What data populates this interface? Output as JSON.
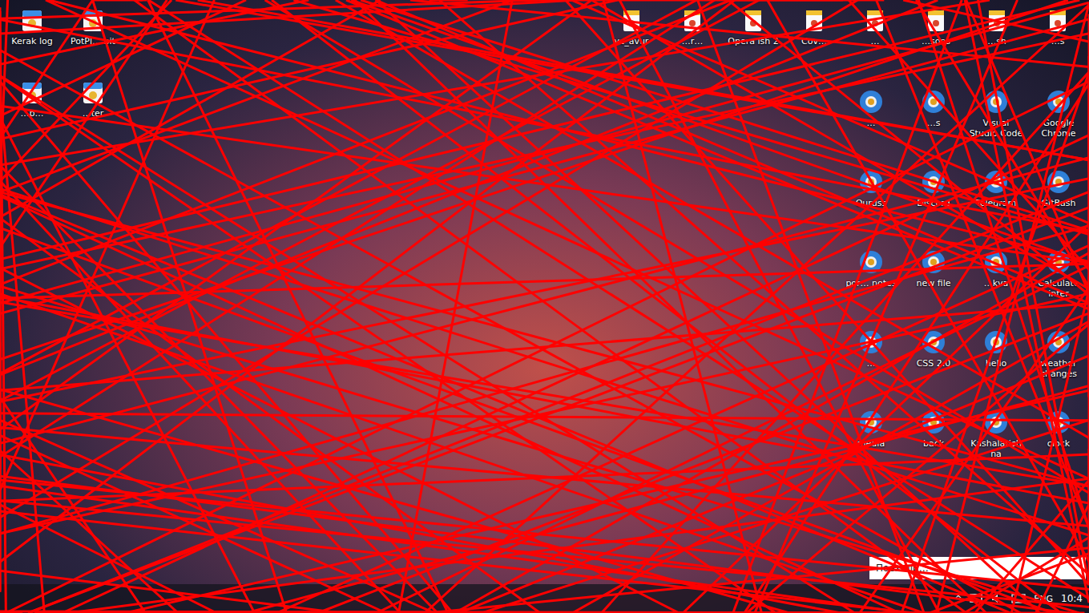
{
  "desktop": {
    "left_icons": [
      {
        "label": "Kerak log"
      },
      {
        "label": "PotPl… bit"
      },
      {
        "label": "…p…"
      },
      {
        "label": "…ter"
      }
    ],
    "top_icons": [
      {
        "label": "vc_avur"
      },
      {
        "label": "…r…"
      },
      {
        "label": "Opera ish 2"
      },
      {
        "label": "Cov…"
      },
      {
        "label": "…"
      },
      {
        "label": "…sons"
      },
      {
        "label": "…sh"
      },
      {
        "label": "…s"
      }
    ],
    "right_icons": [
      {
        "label": "…"
      },
      {
        "label": "…s"
      },
      {
        "label": "Visual Studio Code"
      },
      {
        "label": "Google Chrome"
      },
      {
        "label": "Ouruss"
      },
      {
        "label": "Discord"
      },
      {
        "label": "Telegram"
      },
      {
        "label": "GitBash"
      },
      {
        "label": "por… notes"
      },
      {
        "label": "new file"
      },
      {
        "label": "…kva"
      },
      {
        "label": "Calculate inter"
      },
      {
        "label": "…"
      },
      {
        "label": "CSS 2.0"
      },
      {
        "label": "hello"
      },
      {
        "label": "weather changes"
      },
      {
        "label": "media"
      },
      {
        "label": "back"
      },
      {
        "label": "Kashalarichna"
      },
      {
        "label": "clock"
      }
    ]
  },
  "notification": {
    "text": "Поехали…"
  },
  "taskbar": {
    "tray_arrow": "^",
    "language": "ENG",
    "time": "10:4"
  }
}
